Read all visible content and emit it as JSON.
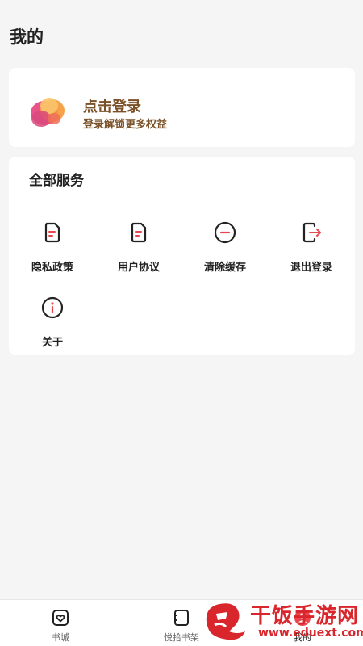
{
  "header": {
    "title": "我的"
  },
  "login": {
    "title": "点击登录",
    "subtitle": "登录解锁更多权益"
  },
  "services": {
    "title": "全部服务",
    "items": [
      {
        "label": "隐私政策",
        "icon": "document-icon"
      },
      {
        "label": "用户协议",
        "icon": "document-icon"
      },
      {
        "label": "清除缓存",
        "icon": "minus-circle-icon"
      },
      {
        "label": "退出登录",
        "icon": "logout-icon"
      },
      {
        "label": "关于",
        "icon": "info-icon"
      }
    ]
  },
  "tabs": [
    {
      "label": "书城",
      "icon": "bookstore-heart-icon",
      "active": false
    },
    {
      "label": "悦拾书架",
      "icon": "bookshelf-icon",
      "active": false
    },
    {
      "label": "我的",
      "icon": "profile-icon",
      "active": true
    }
  ],
  "watermark": {
    "name": "干饭手游网",
    "url": "www.eduext.com"
  },
  "colors": {
    "accent": "#e8474f",
    "login_text": "#7a5128",
    "background": "#f5f5f5",
    "watermark": "#d9262c"
  }
}
